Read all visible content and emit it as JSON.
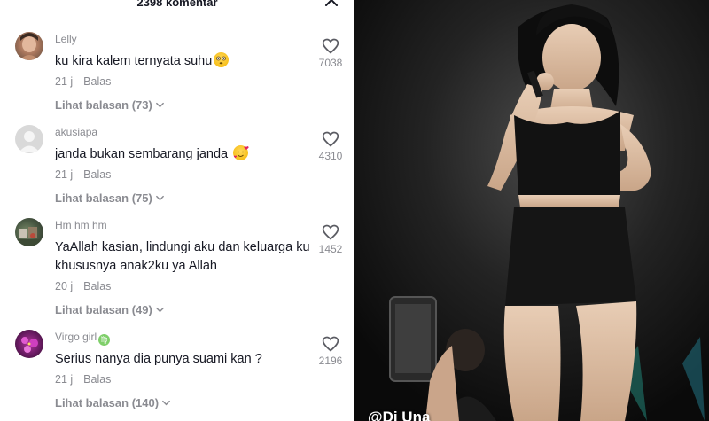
{
  "header": {
    "title": "2398 komentar"
  },
  "comments": [
    {
      "username": "Lelly",
      "text": "ku kira kalem ternyata suhu",
      "emoji": "flushed-face",
      "time": "21 j",
      "reply_label": "Balas",
      "replies_label": "Lihat balasan (73)",
      "likes": "7038"
    },
    {
      "username": "akusiapa",
      "text": "janda bukan sembarang janda",
      "emoji": "smiling-face-with-hearts",
      "time": "21 j",
      "reply_label": "Balas",
      "replies_label": "Lihat balasan (75)",
      "likes": "4310"
    },
    {
      "username": "Hm hm hm",
      "text": "YaAllah kasian, lindungi aku dan keluarga ku khususnya anak2ku ya Allah",
      "time": "20 j",
      "reply_label": "Balas",
      "replies_label": "Lihat balasan (49)",
      "likes": "1452"
    },
    {
      "username": "Virgo girl",
      "badge": "virgo-sign",
      "text": "Serius nanya dia punya suami kan ?",
      "time": "21 j",
      "reply_label": "Balas",
      "replies_label": "Lihat balasan (140)",
      "likes": "2196"
    }
  ],
  "video": {
    "watermark": "@Dj Una"
  },
  "colors": {
    "text": "#161823",
    "muted": "#8a8b91"
  }
}
